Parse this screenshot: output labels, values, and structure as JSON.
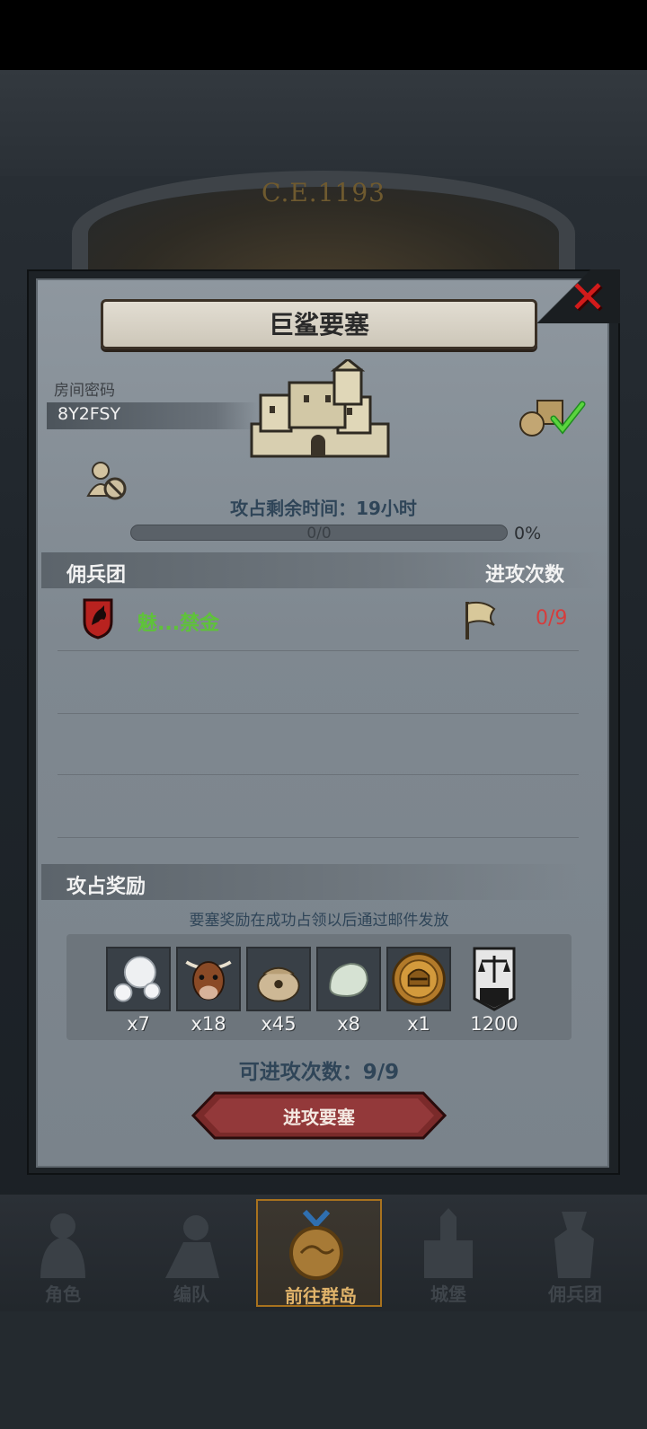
{
  "colors": {
    "accent_green": "#5fc23a",
    "count_red": "#d63c3c",
    "label_blue": "#2f4558",
    "close_red": "#d21b1b",
    "button_red": "#7a2a2a"
  },
  "background": {
    "era_label": "C.E.1193"
  },
  "dialog": {
    "title": "巨鲨要塞",
    "close_icon": "close-x-icon",
    "room": {
      "label": "房间密码",
      "code": "8Y2FSY"
    },
    "icons": {
      "castle": "castle-icon",
      "loot": "loot-check-icon",
      "person": "person-disabled-icon"
    },
    "time_remaining": "攻占剩余时间：19小时",
    "progress": {
      "text": "0/0",
      "percent_label": "0%",
      "fraction": 0
    },
    "mercenary_header": {
      "left": "佣兵团",
      "right": "进攻次数"
    },
    "mercenaries": [
      {
        "name": "魅...禁金",
        "attacks": "0/9",
        "emblem": "wolf-shield-icon"
      }
    ],
    "reward_header": "攻占奖励",
    "reward_note": "要塞奖励在成功占领以后通过邮件发放",
    "rewards": [
      {
        "icon": "pearl-icon",
        "qty": "x7"
      },
      {
        "icon": "cow-icon",
        "qty": "x18"
      },
      {
        "icon": "sack-icon",
        "qty": "x45"
      },
      {
        "icon": "stone-icon",
        "qty": "x8"
      },
      {
        "icon": "helmet-coin-icon",
        "qty": "x1"
      },
      {
        "icon": "scales-banner-icon",
        "qty": "1200"
      }
    ],
    "available_attacks": "可进攻次数：9/9",
    "attack_button": "进攻要塞"
  },
  "bottom_nav": [
    {
      "label": "角色",
      "icon": "knight-icon",
      "active": false
    },
    {
      "label": "编队",
      "icon": "troop-icon",
      "active": false
    },
    {
      "label": "前往群岛",
      "icon": "islands-compass-icon",
      "active": true
    },
    {
      "label": "城堡",
      "icon": "castle-nav-icon",
      "active": false
    },
    {
      "label": "佣兵团",
      "icon": "mercenary-icon",
      "active": false
    }
  ]
}
